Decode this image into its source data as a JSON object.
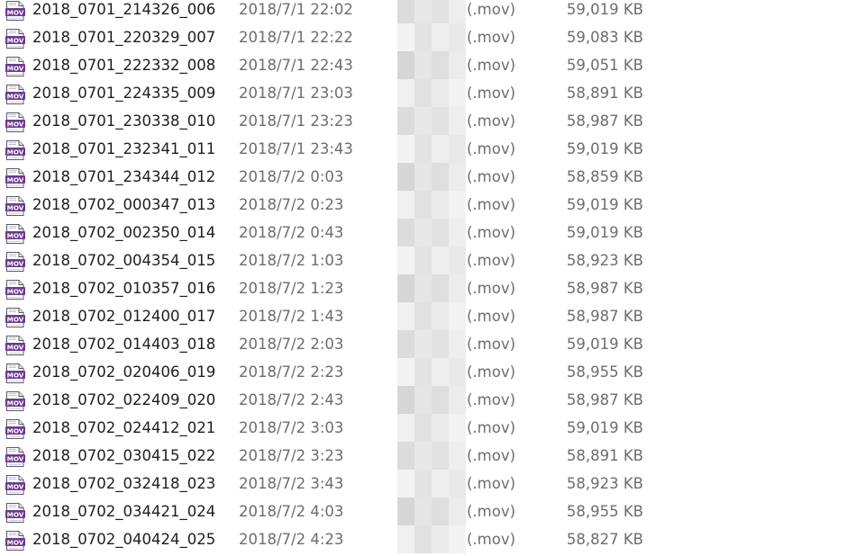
{
  "files": [
    {
      "name": "2018_0701_214326_006",
      "date": "2018/7/1 22:02",
      "type": "(.mov)",
      "size": "59,019 KB",
      "icon": "mov-file-icon"
    },
    {
      "name": "2018_0701_220329_007",
      "date": "2018/7/1 22:22",
      "type": "(.mov)",
      "size": "59,083 KB",
      "icon": "mov-file-icon"
    },
    {
      "name": "2018_0701_222332_008",
      "date": "2018/7/1 22:43",
      "type": "(.mov)",
      "size": "59,051 KB",
      "icon": "mov-file-icon"
    },
    {
      "name": "2018_0701_224335_009",
      "date": "2018/7/1 23:03",
      "type": "(.mov)",
      "size": "58,891 KB",
      "icon": "mov-file-icon"
    },
    {
      "name": "2018_0701_230338_010",
      "date": "2018/7/1 23:23",
      "type": "(.mov)",
      "size": "58,987 KB",
      "icon": "mov-file-icon"
    },
    {
      "name": "2018_0701_232341_011",
      "date": "2018/7/1 23:43",
      "type": "(.mov)",
      "size": "59,019 KB",
      "icon": "mov-file-icon"
    },
    {
      "name": "2018_0701_234344_012",
      "date": "2018/7/2 0:03",
      "type": "(.mov)",
      "size": "58,859 KB",
      "icon": "mov-file-icon"
    },
    {
      "name": "2018_0702_000347_013",
      "date": "2018/7/2 0:23",
      "type": "(.mov)",
      "size": "59,019 KB",
      "icon": "mov-file-icon"
    },
    {
      "name": "2018_0702_002350_014",
      "date": "2018/7/2 0:43",
      "type": "(.mov)",
      "size": "59,019 KB",
      "icon": "mov-file-icon"
    },
    {
      "name": "2018_0702_004354_015",
      "date": "2018/7/2 1:03",
      "type": "(.mov)",
      "size": "58,923 KB",
      "icon": "mov-file-icon"
    },
    {
      "name": "2018_0702_010357_016",
      "date": "2018/7/2 1:23",
      "type": "(.mov)",
      "size": "58,987 KB",
      "icon": "mov-file-icon"
    },
    {
      "name": "2018_0702_012400_017",
      "date": "2018/7/2 1:43",
      "type": "(.mov)",
      "size": "58,987 KB",
      "icon": "mov-file-icon"
    },
    {
      "name": "2018_0702_014403_018",
      "date": "2018/7/2 2:03",
      "type": "(.mov)",
      "size": "59,019 KB",
      "icon": "mov-file-icon"
    },
    {
      "name": "2018_0702_020406_019",
      "date": "2018/7/2 2:23",
      "type": "(.mov)",
      "size": "58,955 KB",
      "icon": "mov-file-icon"
    },
    {
      "name": "2018_0702_022409_020",
      "date": "2018/7/2 2:43",
      "type": "(.mov)",
      "size": "58,987 KB",
      "icon": "mov-file-icon"
    },
    {
      "name": "2018_0702_024412_021",
      "date": "2018/7/2 3:03",
      "type": "(.mov)",
      "size": "59,019 KB",
      "icon": "mov-file-icon"
    },
    {
      "name": "2018_0702_030415_022",
      "date": "2018/7/2 3:23",
      "type": "(.mov)",
      "size": "58,891 KB",
      "icon": "mov-file-icon"
    },
    {
      "name": "2018_0702_032418_023",
      "date": "2018/7/2 3:43",
      "type": "(.mov)",
      "size": "58,923 KB",
      "icon": "mov-file-icon"
    },
    {
      "name": "2018_0702_034421_024",
      "date": "2018/7/2 4:03",
      "type": "(.mov)",
      "size": "58,955 KB",
      "icon": "mov-file-icon"
    },
    {
      "name": "2018_0702_040424_025",
      "date": "2018/7/2 4:23",
      "type": "(.mov)",
      "size": "58,827 KB",
      "icon": "mov-file-icon"
    }
  ],
  "colors": {
    "name_text": "#1e1e1e",
    "secondary_text": "#6d6d6d",
    "icon_purple": "#6b3a8e"
  }
}
